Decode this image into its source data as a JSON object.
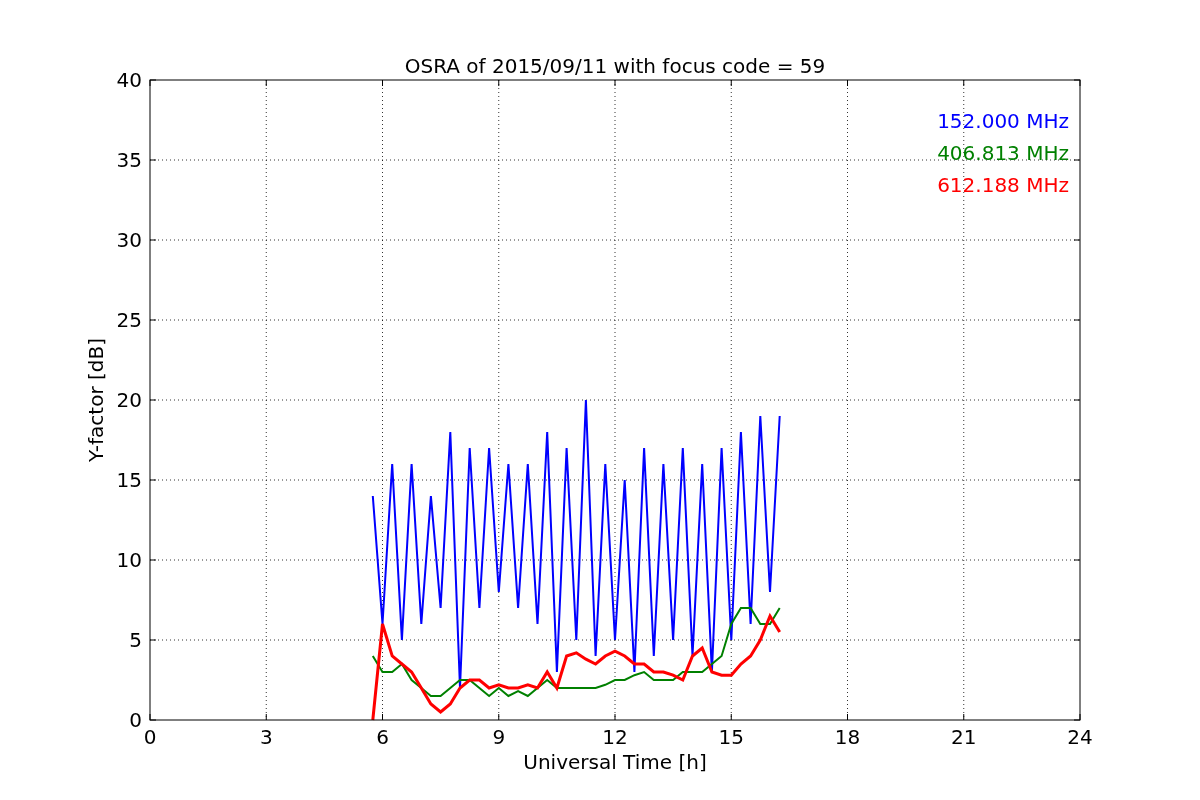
{
  "chart_data": {
    "type": "line",
    "title": "OSRA of 2015/09/11 with focus code = 59",
    "xlabel": "Universal Time [h]",
    "ylabel": "Y-factor [dB]",
    "x": [
      5.75,
      6,
      6.25,
      6.5,
      6.75,
      7,
      7.25,
      7.5,
      7.75,
      8,
      8.25,
      8.5,
      8.75,
      9,
      9.25,
      9.5,
      9.75,
      10,
      10.25,
      10.5,
      10.75,
      11,
      11.25,
      11.5,
      11.75,
      12,
      12.25,
      12.5,
      12.75,
      13,
      13.25,
      13.5,
      13.75,
      14,
      14.25,
      14.5,
      14.75,
      15,
      15.25,
      15.5,
      15.75,
      16,
      16.25
    ],
    "series": [
      {
        "name": "152.000 MHz",
        "color": "#0000ff",
        "values": [
          14,
          6,
          16,
          5,
          16,
          6,
          14,
          7,
          18,
          2,
          17,
          7,
          17,
          8,
          16,
          7,
          16,
          6,
          18,
          3,
          17,
          5,
          20,
          4,
          16,
          5,
          15,
          3,
          17,
          4,
          16,
          5,
          17,
          4,
          16,
          3,
          17,
          5,
          18,
          6,
          19,
          8,
          19
        ]
      },
      {
        "name": "406.813 MHz",
        "color": "#008000",
        "values": [
          4,
          3,
          3,
          3.5,
          2.5,
          2,
          1.5,
          1.5,
          2,
          2.5,
          2.5,
          2,
          1.5,
          2,
          1.5,
          1.8,
          1.5,
          2,
          2.5,
          2,
          2,
          2,
          2,
          2,
          2.2,
          2.5,
          2.5,
          2.8,
          3,
          2.5,
          2.5,
          2.5,
          3,
          3,
          3,
          3.5,
          4,
          6,
          7,
          7,
          6,
          6,
          7
        ]
      },
      {
        "name": "612.188 MHz",
        "color": "#ff0000",
        "values": [
          0,
          6,
          4,
          3.5,
          3,
          2,
          1,
          0.5,
          1,
          2,
          2.5,
          2.5,
          2,
          2.2,
          2,
          2,
          2.2,
          2,
          3,
          2,
          4,
          4.2,
          3.8,
          3.5,
          4,
          4.3,
          4,
          3.5,
          3.5,
          3,
          3,
          2.8,
          2.5,
          4,
          4.5,
          3,
          2.8,
          2.8,
          3.5,
          4,
          5,
          6.5,
          5.5
        ]
      }
    ],
    "xlim": [
      0,
      24
    ],
    "ylim": [
      0,
      40
    ],
    "grid": true,
    "xticks": [
      0,
      3,
      6,
      9,
      12,
      15,
      18,
      21,
      24
    ],
    "yticks": [
      0,
      5,
      10,
      15,
      20,
      25,
      30,
      35,
      40
    ]
  }
}
